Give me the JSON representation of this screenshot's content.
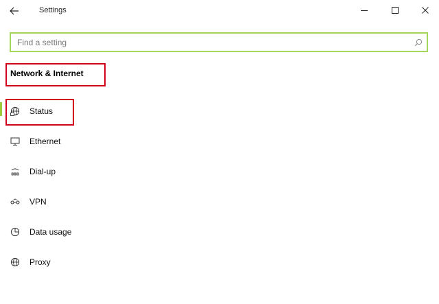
{
  "window": {
    "title": "Settings",
    "back_icon": "arrow-left-icon",
    "minimize_icon": "minimize-icon",
    "maximize_icon": "maximize-icon",
    "close_icon": "close-icon"
  },
  "search": {
    "placeholder": "Find a setting",
    "value": "",
    "icon": "search-icon"
  },
  "section": {
    "title": "Network & Internet"
  },
  "nav": {
    "items": [
      {
        "label": "Status",
        "icon": "globe-status-icon",
        "selected": true
      },
      {
        "label": "Ethernet",
        "icon": "ethernet-monitor-icon",
        "selected": false
      },
      {
        "label": "Dial-up",
        "icon": "dial-up-phone-icon",
        "selected": false
      },
      {
        "label": "VPN",
        "icon": "vpn-icon",
        "selected": false
      },
      {
        "label": "Data usage",
        "icon": "data-usage-icon",
        "selected": false
      },
      {
        "label": "Proxy",
        "icon": "globe-proxy-icon",
        "selected": false
      }
    ]
  },
  "colors": {
    "accent": "#9ccc3b",
    "highlight": "#d0021b"
  }
}
